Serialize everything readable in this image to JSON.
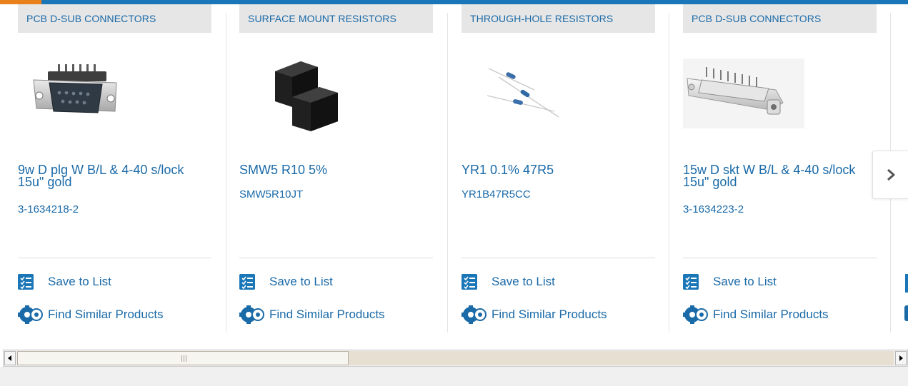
{
  "colors": {
    "brand_blue": "#1a76b7",
    "accent_orange": "#e8801c",
    "link_blue": "#1a6aa8",
    "category_bg": "#e6e6e6"
  },
  "products": [
    {
      "category": "PCB D-SUB CONNECTORS",
      "title": "9w D plg W B/L & 4-40 s/lock 15u\" gold",
      "part_number": "3-1634218-2",
      "save_label": "Save to List",
      "similar_label": "Find Similar Products",
      "image_icon": "dsub-plug-connector-image"
    },
    {
      "category": "SURFACE MOUNT RESISTORS",
      "title": "SMW5 R10 5%",
      "part_number": "SMW5R10JT",
      "save_label": "Save to List",
      "similar_label": "Find Similar Products",
      "image_icon": "smd-resistor-image"
    },
    {
      "category": "THROUGH-HOLE RESISTORS",
      "title": "YR1 0.1% 47R5",
      "part_number": "YR1B47R5CC",
      "save_label": "Save to List",
      "similar_label": "Find Similar Products",
      "image_icon": "axial-resistor-image"
    },
    {
      "category": "PCB D-SUB CONNECTORS",
      "title": "15w D skt W B/L & 4-40 s/lock 15u\" gold",
      "part_number": "3-1634223-2",
      "save_label": "Save to List",
      "similar_label": "Find Similar Products",
      "image_icon": "dsub-socket-connector-image"
    }
  ],
  "carousel": {
    "next_icon": "chevron-right-icon"
  },
  "scrollbar": {
    "left_icon": "scroll-left-arrow-icon",
    "right_icon": "scroll-right-arrow-icon"
  }
}
